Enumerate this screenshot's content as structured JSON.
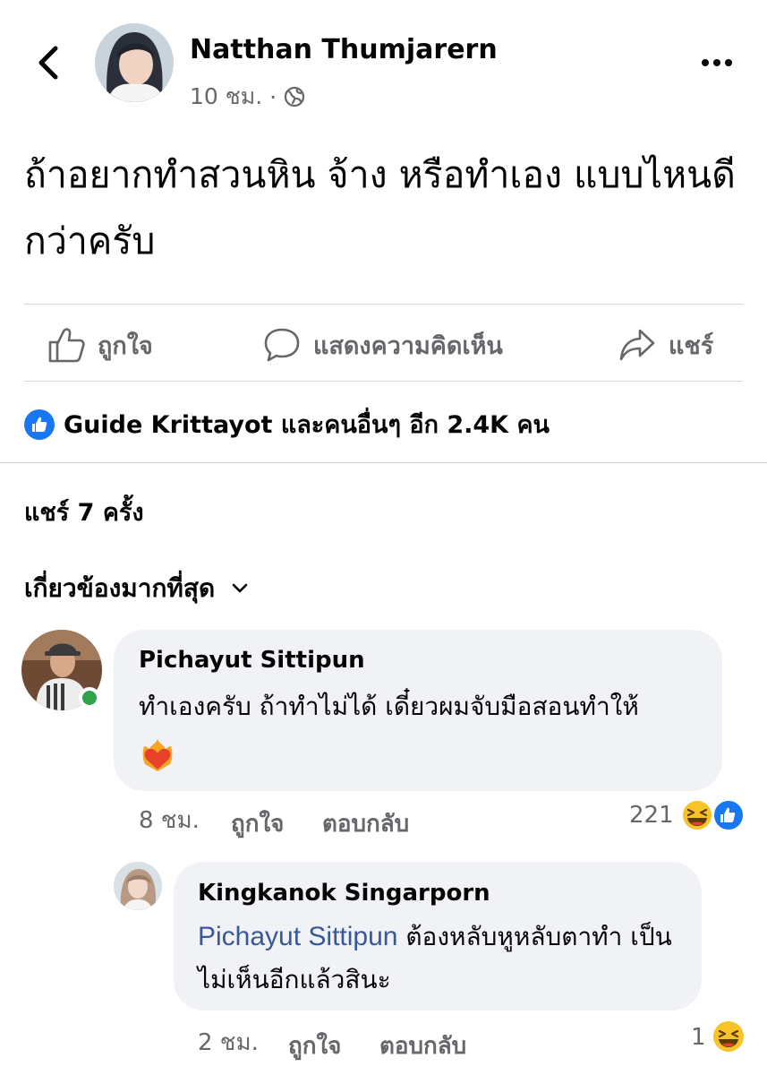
{
  "post": {
    "author": "Natthan Thumjarern",
    "time": "10 ชม.",
    "separator": "·",
    "text": "ถ้าอยากทำสวนหิน จ้าง หรือทำเอง แบบไหนดีกว่าครับ"
  },
  "actions": {
    "like": "ถูกใจ",
    "comment": "แสดงความคิดเห็น",
    "share": "แชร์"
  },
  "likes_summary": "Guide Krittayot และคนอื่นๆ อีก 2.4K คน",
  "shares_count": "แชร์ 7 ครั้ง",
  "sort_label": "เกี่ยวข้องมากที่สุด",
  "comments": [
    {
      "name": "Pichayut Sittipun",
      "text": "ทำเองครับ ถ้าทำไม่ได้ เดี๋ยวผมจับมือสอนทำให้",
      "time": "8 ชม.",
      "like": "ถูกใจ",
      "reply": "ตอบกลับ",
      "reaction_count": "221",
      "reactions": [
        "haha-emoji",
        "like-emoji"
      ],
      "online": true
    },
    {
      "name": "Kingkanok Singarporn",
      "mention": "Pichayut Sittipun",
      "text": " ต้องหลับหูหลับตาทำ เป็นไม่เห็นอีกแล้วสินะ",
      "time": "2 ชม.",
      "like": "ถูกใจ",
      "reply": "ตอบกลับ",
      "reaction_count": "1",
      "reactions": [
        "haha-emoji"
      ]
    }
  ],
  "colors": {
    "accent": "#1877f2",
    "secondary_text": "#65676b",
    "bubble": "#f0f2f5",
    "mention": "#385898",
    "online": "#31a24c"
  }
}
